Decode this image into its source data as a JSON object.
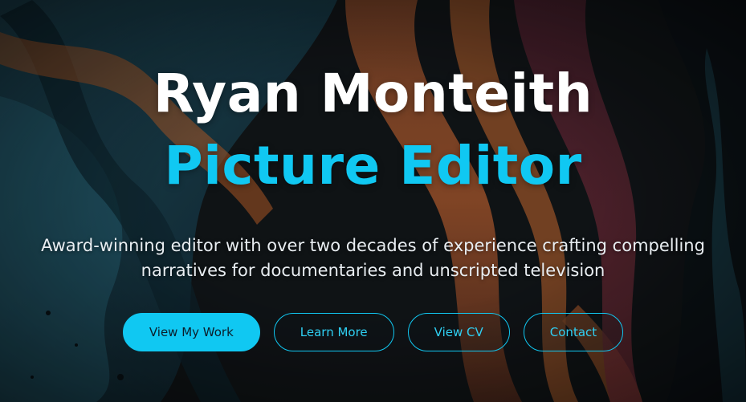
{
  "hero": {
    "name": "Ryan Monteith",
    "role": "Picture Editor",
    "tagline": "Award-winning editor with over two decades of experience crafting compelling narratives for documentaries and unscripted television"
  },
  "buttons": {
    "view_work": "View My Work",
    "learn_more": "Learn More",
    "view_cv": "View CV",
    "contact": "Contact"
  },
  "colors": {
    "accent": "#10c8f2",
    "title": "#ffffff",
    "background": "#14181c"
  }
}
